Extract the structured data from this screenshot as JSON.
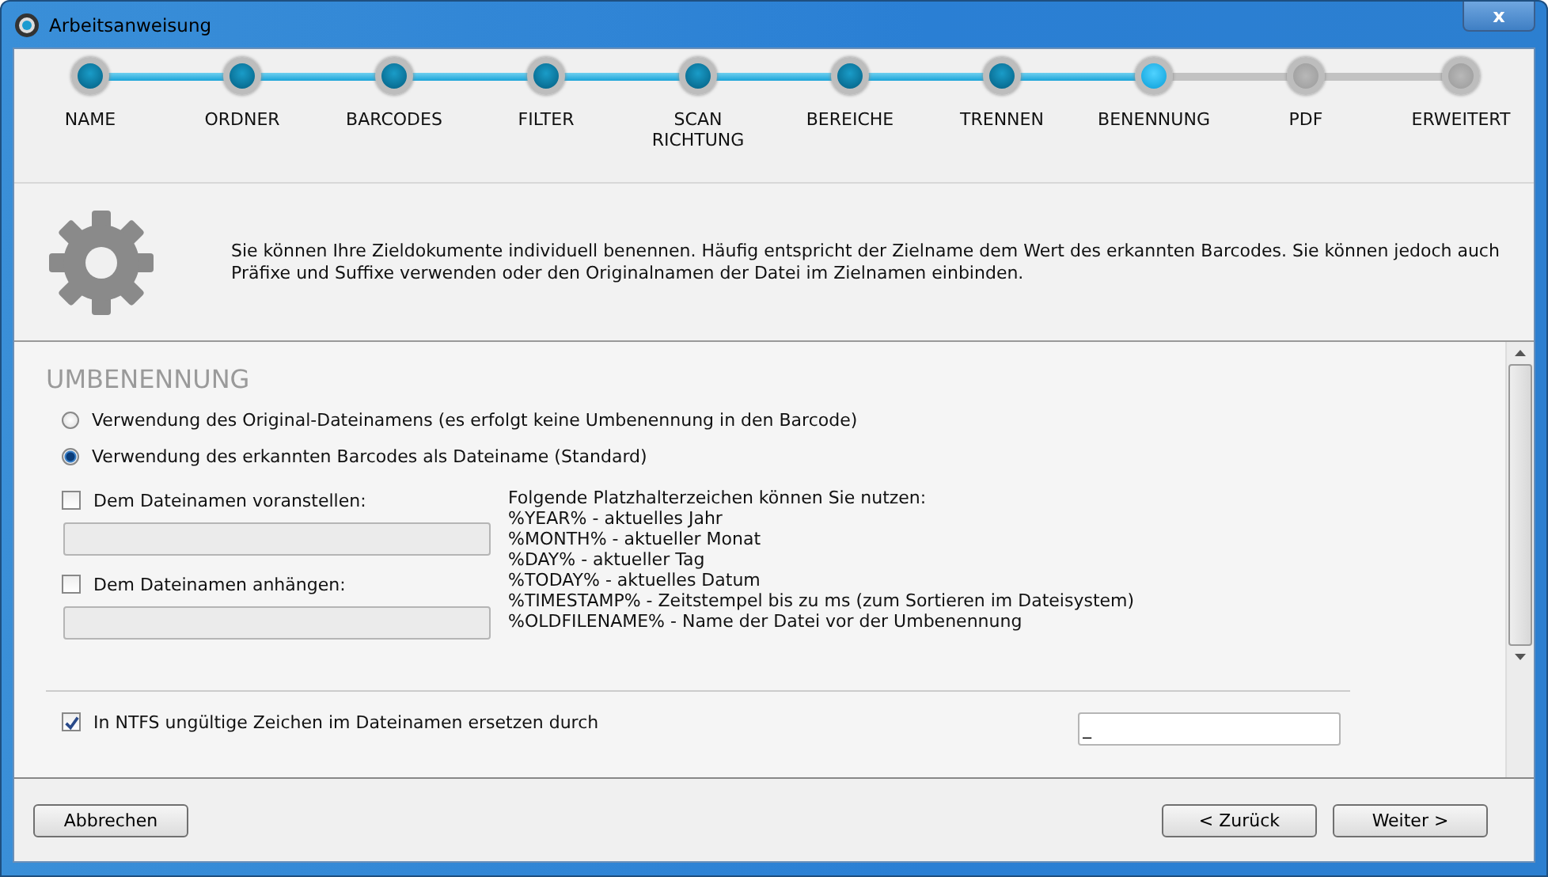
{
  "window": {
    "title": "Arbeitsanweisung",
    "close_label": "x"
  },
  "steps": [
    {
      "label": "NAME",
      "completed": true,
      "selected": false
    },
    {
      "label": "ORDNER",
      "completed": true,
      "selected": false
    },
    {
      "label": "BARCODES",
      "completed": true,
      "selected": false
    },
    {
      "label": "FILTER",
      "completed": true,
      "selected": false
    },
    {
      "label": "SCAN\nRICHTUNG",
      "completed": true,
      "selected": false
    },
    {
      "label": "BEREICHE",
      "completed": true,
      "selected": false
    },
    {
      "label": "TRENNEN",
      "completed": true,
      "selected": false
    },
    {
      "label": "BENENNUNG",
      "completed": false,
      "selected": true
    },
    {
      "label": "PDF",
      "completed": false,
      "selected": false
    },
    {
      "label": "ERWEITERT",
      "completed": false,
      "selected": false
    }
  ],
  "info": {
    "text": "Sie können Ihre Zieldokumente individuell benennen. Häufig entspricht der Zielname dem Wert des erkannten Barcodes. Sie können jedoch auch Präfixe und Suffixe verwenden oder den Originalnamen der Datei im Zielnamen einbinden."
  },
  "section": {
    "title": "UMBENENNUNG",
    "radios": [
      {
        "label": "Verwendung des Original-Dateinamens (es erfolgt keine Umbenennung in den Barcode)",
        "selected": false
      },
      {
        "label": "Verwendung des erkannten Barcodes als Dateiname (Standard)",
        "selected": true
      }
    ],
    "affixes": [
      {
        "label": "Dem Dateinamen voranstellen:",
        "checked": false,
        "disabled": true
      },
      {
        "label": "Dem Dateinamen anhängen:",
        "checked": false,
        "disabled": true
      }
    ],
    "placeholder_help": [
      "Folgende Platzhalterzeichen können Sie nutzen:",
      "%YEAR% - aktuelles Jahr",
      "%MONTH% - aktueller Monat",
      "%DAY% - aktueller Tag",
      "%TODAY% - aktuelles Datum",
      "%TIMESTAMP% - Zeitstempel bis zu ms (zum Sortieren im Dateisystem)",
      "%OLDFILENAME% - Name der Datei vor der Umbenennung"
    ],
    "ntfs": {
      "label": "In NTFS ungültige Zeichen im Dateinamen ersetzen durch",
      "checked": true,
      "value": "_"
    }
  },
  "buttons": {
    "cancel": "Abbrechen",
    "back": "< Zurück",
    "next": "Weiter >"
  }
}
